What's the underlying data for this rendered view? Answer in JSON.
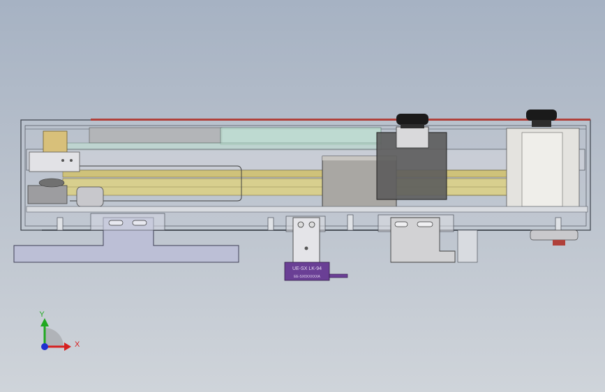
{
  "viewport": {
    "background_top": "#a6b2c3",
    "background_bottom": "#cfd4da"
  },
  "model": {
    "sensor_label_line1": "UE-SX LK-94",
    "sensor_label_line2": "EE-SX0XXXXXA",
    "colors": {
      "housing_outline": "#3a3f48",
      "plate_fill": "#bcbfd6",
      "rail_yellow": "#cfc27a",
      "motor_dark": "#555555",
      "block_gray": "#a9a7a3",
      "sensor_purple": "#6a3f95",
      "red_strip": "#b0403a",
      "knob_black": "#1a1a1a",
      "green_panel": "#bfe0d2"
    }
  },
  "triad": {
    "x_label": "X",
    "y_label": "Y",
    "x_color": "#d62020",
    "y_color": "#21a821",
    "z_color": "#2030d0"
  }
}
